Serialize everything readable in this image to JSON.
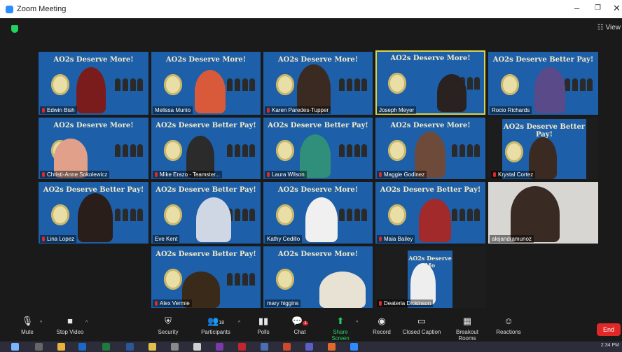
{
  "window": {
    "title": "Zoom Meeting",
    "view_label": "View"
  },
  "banners": {
    "more": "AO2s Deserve More!",
    "better_pay": "AO2s Deserve Better Pay!",
    "more_partial": "AO2s Deserve Mo"
  },
  "participants": [
    {
      "name": "Edwin Bish"
    },
    {
      "name": "Melissa Munio"
    },
    {
      "name": "Karen Paredes-Tupper"
    },
    {
      "name": "Joseph Meyer"
    },
    {
      "name": "Rocio Richards"
    },
    {
      "name": "Christi-Anne Sokolewicz"
    },
    {
      "name": "Mike Erazo - Teamster..."
    },
    {
      "name": "Laura Wilson"
    },
    {
      "name": "Maggie Godinez"
    },
    {
      "name": "Krystal Cortez"
    },
    {
      "name": "Lina Lopez"
    },
    {
      "name": "Eve Kent"
    },
    {
      "name": "Kathy Cedillo"
    },
    {
      "name": "Maia Bailey"
    },
    {
      "name": "alejandramunoz"
    },
    {
      "name": "Alex Vermie"
    },
    {
      "name": "mary higgins"
    },
    {
      "name": "Deateria Dickinson"
    }
  ],
  "toolbar": {
    "mute": "Mute",
    "stop_video": "Stop Video",
    "security": "Security",
    "participants": "Participants",
    "participants_count": "18",
    "polls": "Polls",
    "chat": "Chat",
    "chat_badge": "1",
    "share_screen": "Share Screen",
    "record": "Record",
    "closed_caption": "Closed Caption",
    "breakout_rooms": "Breakout Rooms",
    "reactions": "Reactions",
    "end": "End"
  },
  "taskbar": {
    "time": "2:34 PM"
  },
  "colors": {
    "tile_bg": "#1d5fa8",
    "share_green": "#23d160",
    "end_red": "#e02828",
    "active_speaker": "#d8d44a"
  }
}
